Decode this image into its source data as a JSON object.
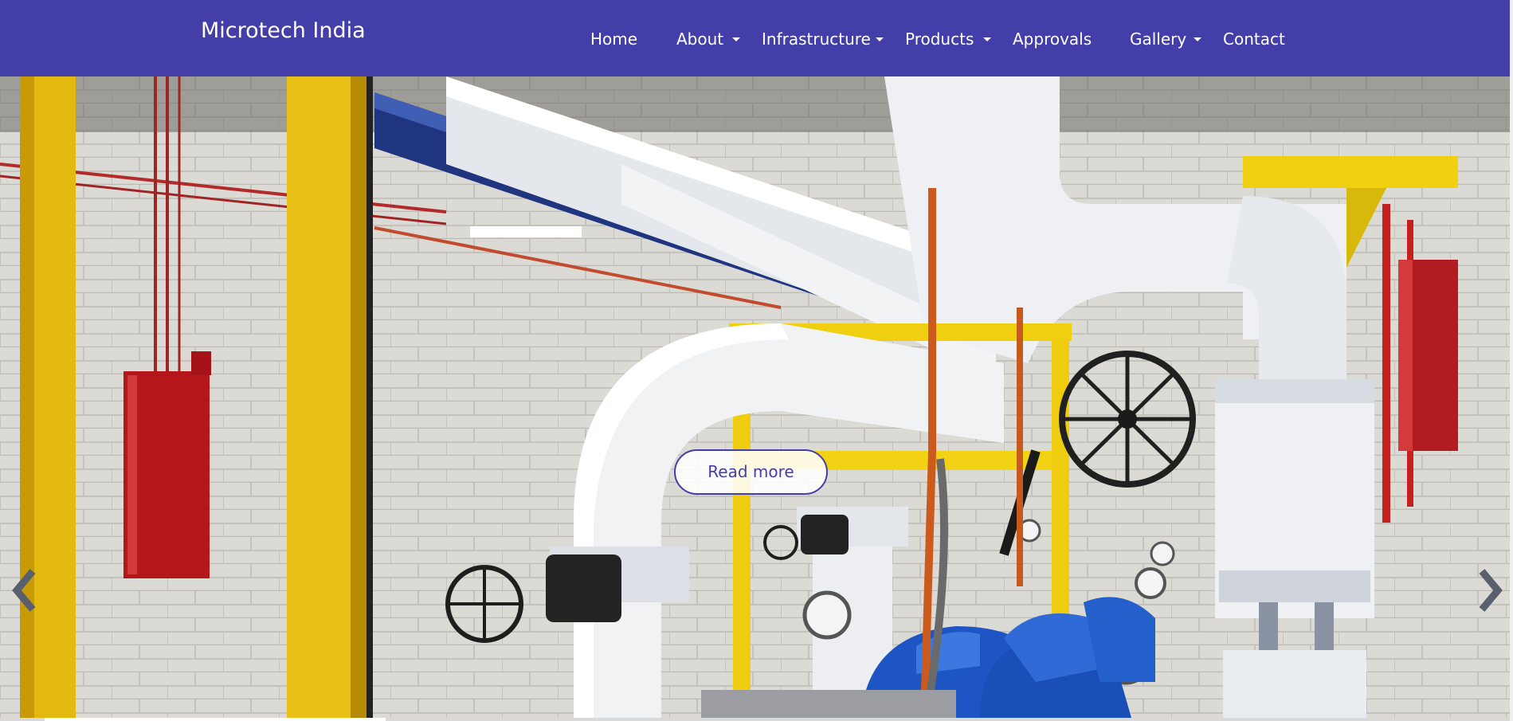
{
  "site": {
    "brand": "Microtech India",
    "accent_color": "#443ea8"
  },
  "nav": {
    "items": [
      {
        "label": "Home",
        "has_dropdown": false
      },
      {
        "label": "About",
        "has_dropdown": true
      },
      {
        "label": "Infrastructure",
        "has_dropdown": true
      },
      {
        "label": "Products",
        "has_dropdown": true
      },
      {
        "label": "Approvals",
        "has_dropdown": false
      },
      {
        "label": "Gallery",
        "has_dropdown": true
      },
      {
        "label": "Contact",
        "has_dropdown": false
      }
    ]
  },
  "hero": {
    "button_label": "Read more",
    "prev_icon": "chevron-left-icon",
    "next_icon": "chevron-right-icon"
  }
}
